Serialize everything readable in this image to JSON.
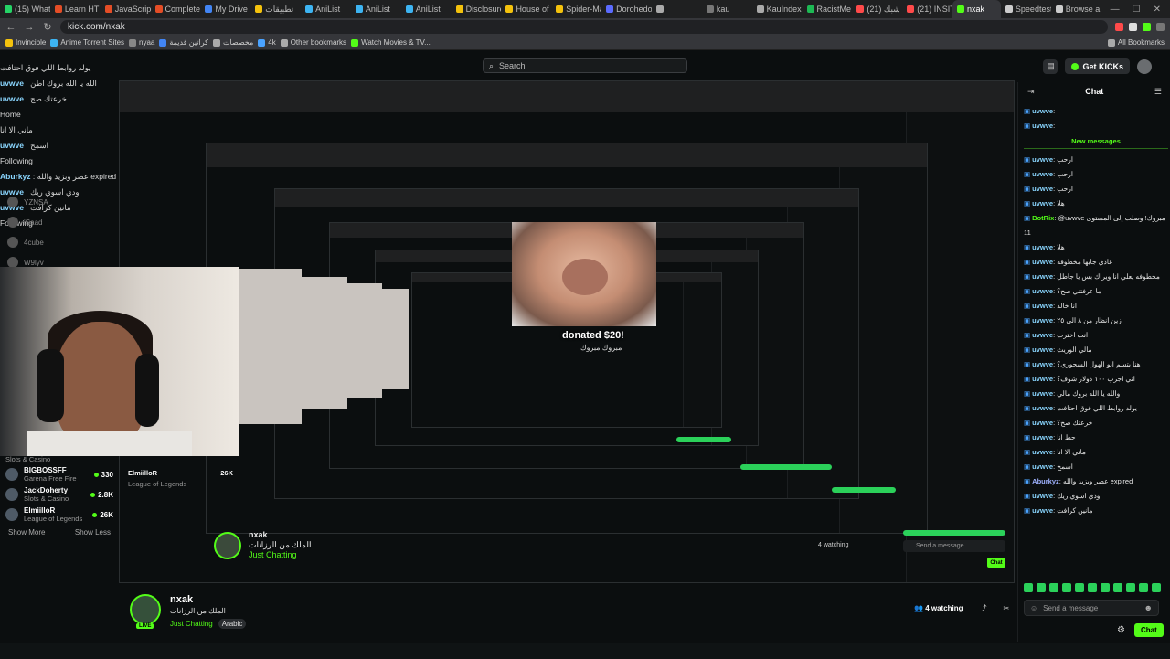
{
  "browser": {
    "tabs": [
      {
        "label": "(15) Whats",
        "color": "#25d366"
      },
      {
        "label": "Learn HT",
        "color": "#e44d26"
      },
      {
        "label": "JavaScript",
        "color": "#e44d26"
      },
      {
        "label": "Complete",
        "color": "#e44d26"
      },
      {
        "label": "My Drive",
        "color": "#4285f4"
      },
      {
        "label": "تطبيقات",
        "color": "#f4c20d"
      },
      {
        "label": "AniList",
        "color": "#3db4f2"
      },
      {
        "label": "AniList",
        "color": "#3db4f2"
      },
      {
        "label": "AniList",
        "color": "#3db4f2"
      },
      {
        "label": "Disclosure",
        "color": "#f4c20d"
      },
      {
        "label": "House of",
        "color": "#f4c20d"
      },
      {
        "label": "Spider-Ma",
        "color": "#f4c20d"
      },
      {
        "label": "Dorohedo",
        "color": "#5b6bff"
      },
      {
        "label": "",
        "color": "#aaaaaa"
      },
      {
        "label": "kau",
        "color": "#777777"
      },
      {
        "label": "KauIndex",
        "color": "#aaaaaa"
      },
      {
        "label": "RacistMe",
        "color": "#1db954"
      },
      {
        "label": "(21) شبك",
        "color": "#ff4a4a"
      },
      {
        "label": "(21) INSIT",
        "color": "#ff4a4a"
      },
      {
        "label": "nxak",
        "color": "#53fc18"
      },
      {
        "label": "Speedtest",
        "color": "#cccccc"
      },
      {
        "label": "Browse a",
        "color": "#cccccc"
      }
    ],
    "active_tab_index": 19,
    "url": "kick.com/nxak",
    "bookmarks": [
      "Invincible",
      "Anime Torrent Sites",
      "nyaa",
      "كراتين قديمة",
      "مخصصات",
      "4k"
    ],
    "other_bookmarks": "Other bookmarks",
    "watch_movies": "Watch Movies & TV...",
    "all_bookmarks": "All Bookmarks"
  },
  "kick": {
    "search_placeholder": "Search",
    "get_kicks": "Get KICKs"
  },
  "left_overlay": {
    "lines": [
      {
        "text": "يولد روابط اللي فوق احتافت"
      },
      {
        "user": "uvwve",
        "text": "الله يا الله بروك اطن"
      },
      {
        "user": "uvwve",
        "text": "خرعتك صح"
      },
      {
        "text": "Home"
      },
      {
        "text": "ماني الا انا"
      },
      {
        "user": "uvwve",
        "text": "اسمح"
      },
      {
        "text": "Following"
      },
      {
        "user": "Aburkyz",
        "text": "عصر وبزيد والله expired"
      },
      {
        "user": "uvwve",
        "text": "ودي اسوي ريك"
      },
      {
        "user": "uvwve",
        "text": "مانين كرافت"
      },
      {
        "text": "Following"
      }
    ],
    "follow_list": [
      "YZNSA",
      "iSaad",
      "4cube",
      "W9lyv"
    ]
  },
  "channels": [
    {
      "name": "BIGBOSSFF",
      "category": "Garena Free Fire",
      "viewers": "330"
    },
    {
      "name": "JackDoherty",
      "category": "Slots & Casino",
      "viewers": "2.8K"
    },
    {
      "name": "ElmiilloR",
      "category": "League of Legends",
      "viewers": "26K"
    }
  ],
  "channels_header": "Slots & Casino",
  "mini_channels": [
    {
      "name": "ElmiilloR",
      "category": "League of Legends",
      "viewers": "26K"
    }
  ],
  "show_more": "Show More",
  "show_less": "Show Less",
  "donation": {
    "text": "donated $20!",
    "sub": "مبروك مبروك"
  },
  "stream": {
    "channel": "nxak",
    "title": "الملك من الرزانات",
    "category": "Just Chatting",
    "language": "Arabic",
    "watching": "4 watching",
    "live": "LIVE"
  },
  "chat": {
    "header": "Chat",
    "new_messages": "New messages",
    "messages": [
      {
        "user": "uvwve",
        "text": ""
      },
      {
        "user": "uvwve",
        "text": ""
      },
      {
        "user": "uvwve",
        "text": "ارحب"
      },
      {
        "user": "uvwve",
        "text": "ارحب"
      },
      {
        "user": "uvwve",
        "text": "ارحب"
      },
      {
        "user": "uvwve",
        "text": "هلا"
      },
      {
        "user": "BotRix",
        "text": "@uvwve مبروك! وصلت إلى المستوى",
        "bot": true
      },
      {
        "user": "",
        "text": "11"
      },
      {
        "user": "uvwve",
        "text": "هلا"
      },
      {
        "user": "uvwve",
        "text": "عادي جايها مخطوفه"
      },
      {
        "user": "uvwve",
        "text": "مخطوفه يعلي انا ويراك بس يا جاطل"
      },
      {
        "user": "uvwve",
        "text": "ما عرفتني صح؟"
      },
      {
        "user": "uvwve",
        "text": "انا خالد"
      },
      {
        "user": "uvwve",
        "text": "زين انظار من ٨ الى ٢٥"
      },
      {
        "user": "uvwve",
        "text": "انت اخترت"
      },
      {
        "user": "uvwve",
        "text": "مالي الوريث"
      },
      {
        "user": "uvwve",
        "text": "هنا يتسم ابو الهول السحوري؟"
      },
      {
        "user": "uvwve",
        "text": "اني اجرب ١٠٠ دولار شوف؟"
      },
      {
        "user": "uvwve",
        "text": "والله يا الله بروك مالي"
      },
      {
        "user": "uvwve",
        "text": "يولد روابط اللي فوق احتافت"
      },
      {
        "user": "uvwve",
        "text": "خرعتك صح؟"
      },
      {
        "user": "uvwve",
        "text": "حط انا"
      },
      {
        "user": "uvwve",
        "text": "ماني الا انا"
      },
      {
        "user": "uvwve",
        "text": "اسمح"
      },
      {
        "user": "Aburkyz",
        "text": "عصر وبزيد والله expired",
        "ab": true
      },
      {
        "user": "uvwve",
        "text": "ودي اسوي ريك"
      },
      {
        "user": "uvwve",
        "text": "مانين كرافت"
      }
    ],
    "send_placeholder": "Send a message",
    "chat_button": "Chat"
  },
  "colors": {
    "accent": "#53fc18",
    "background": "#0b0e0f",
    "username": "#8ad6ff"
  }
}
